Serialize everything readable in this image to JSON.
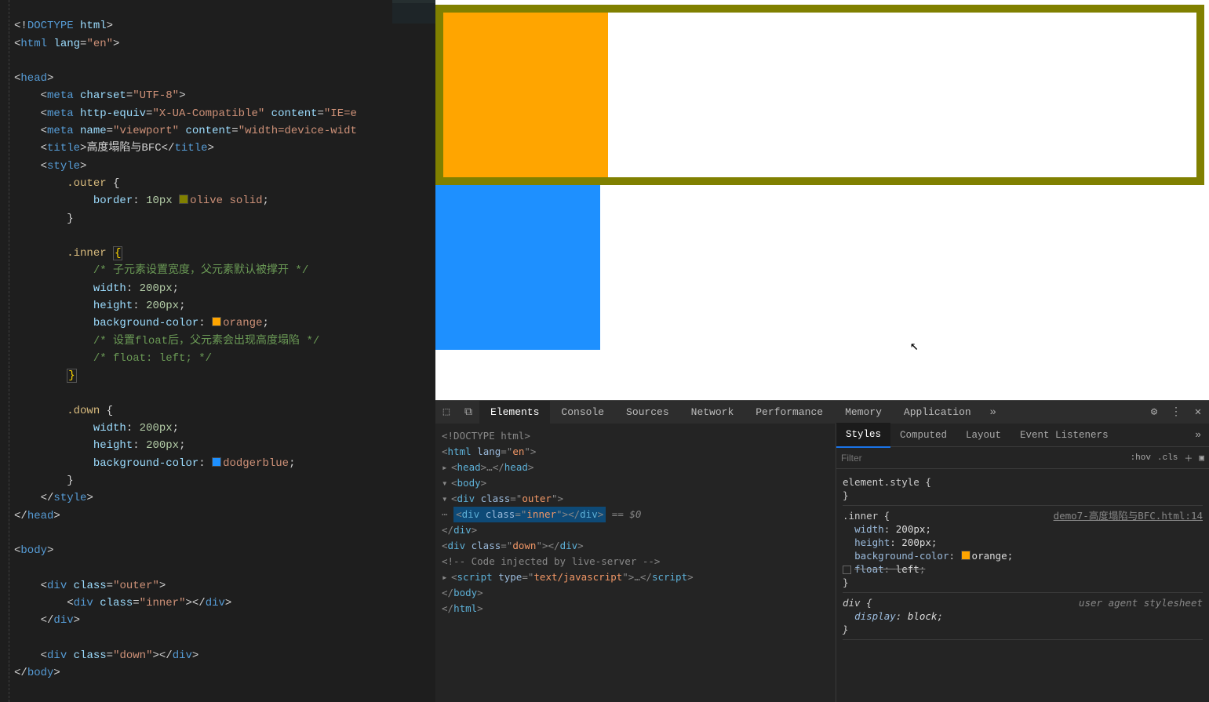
{
  "editor": {
    "l1a": "<!",
    "l1b": "DOCTYPE",
    "l1c": " html",
    "l1d": ">",
    "l2a": "<",
    "l2b": "html",
    "l2c": " lang",
    "l2d": "=",
    "l2e": "\"en\"",
    "l2f": ">",
    "l3a": "<",
    "l3b": "head",
    "l3c": ">",
    "l4a": "<",
    "l4b": "meta",
    "l4c": " charset",
    "l4d": "=",
    "l4e": "\"UTF-8\"",
    "l4f": ">",
    "l5a": "<",
    "l5b": "meta",
    "l5c": " http-equiv",
    "l5d": "=",
    "l5e": "\"X-UA-Compatible\"",
    "l5f": " content",
    "l5g": "=",
    "l5h": "\"IE=e",
    "l6a": "<",
    "l6b": "meta",
    "l6c": " name",
    "l6d": "=",
    "l6e": "\"viewport\"",
    "l6f": " content",
    "l6g": "=",
    "l6h": "\"width=device-widt",
    "l7a": "<",
    "l7b": "title",
    "l7c": ">",
    "l7d": "高度塌陷与BFC",
    "l7e": "</",
    "l7f": "title",
    "l7g": ">",
    "l8a": "<",
    "l8b": "style",
    "l8c": ">",
    "l9a": ".outer",
    "l9b": " {",
    "l10a": "border",
    "l10b": ": ",
    "l10c": "10px",
    "l10d": " ",
    "l10e": "olive",
    "l10f": " ",
    "l10g": "solid",
    "l10h": ";",
    "l11": "}",
    "l12a": ".inner",
    "l12b": " ",
    "l12c": "{",
    "l13": "/* 子元素设置宽度，父元素默认被撑开 */",
    "l14a": "width",
    "l14b": ": ",
    "l14c": "200px",
    "l14d": ";",
    "l15a": "height",
    "l15b": ": ",
    "l15c": "200px",
    "l15d": ";",
    "l16a": "background-color",
    "l16b": ": ",
    "l16c": "orange",
    "l16d": ";",
    "l17": "/* 设置float后，父元素会出现高度塌陷 */",
    "l18": "/* float: left; */",
    "l19": "}",
    "l20a": ".down",
    "l20b": " {",
    "l21a": "width",
    "l21b": ": ",
    "l21c": "200px",
    "l21d": ";",
    "l22a": "height",
    "l22b": ": ",
    "l22c": "200px",
    "l22d": ";",
    "l23a": "background-color",
    "l23b": ": ",
    "l23c": "dodgerblue",
    "l23d": ";",
    "l24": "}",
    "l25a": "</",
    "l25b": "style",
    "l25c": ">",
    "l26a": "</",
    "l26b": "head",
    "l26c": ">",
    "l27a": "<",
    "l27b": "body",
    "l27c": ">",
    "l28a": "<",
    "l28b": "div",
    "l28c": " class",
    "l28d": "=",
    "l28e": "\"outer\"",
    "l28f": ">",
    "l29a": "<",
    "l29b": "div",
    "l29c": " class",
    "l29d": "=",
    "l29e": "\"inner\"",
    "l29f": "></",
    "l29g": "div",
    "l29h": ">",
    "l30a": "</",
    "l30b": "div",
    "l30c": ">",
    "l31a": "<",
    "l31b": "div",
    "l31c": " class",
    "l31d": "=",
    "l31e": "\"down\"",
    "l31f": "></",
    "l31g": "div",
    "l31h": ">",
    "l32a": "</",
    "l32b": "body",
    "l32c": ">"
  },
  "devtools": {
    "tabs": {
      "elements": "Elements",
      "console": "Console",
      "sources": "Sources",
      "network": "Network",
      "performance": "Performance",
      "memory": "Memory",
      "application": "Application"
    },
    "dom": {
      "l1": "<!DOCTYPE html>",
      "l2a": "<",
      "l2b": "html",
      "l2c": " lang",
      "l2d": "=\"",
      "l2e": "en",
      "l2f": "\">",
      "l3a": "<",
      "l3b": "head",
      "l3c": ">",
      "l3d": "…",
      "l3e": "</",
      "l3f": "head",
      "l3g": ">",
      "l4a": "<",
      "l4b": "body",
      "l4c": ">",
      "l5a": "<",
      "l5b": "div",
      "l5c": " class",
      "l5d": "=\"",
      "l5e": "outer",
      "l5f": "\">",
      "l6a": "<",
      "l6b": "div",
      "l6c": " class",
      "l6d": "=\"",
      "l6e": "inner",
      "l6f": "\">",
      "l6g": "</",
      "l6h": "div",
      "l6i": ">",
      "l6j": " == $0",
      "l7a": "</",
      "l7b": "div",
      "l7c": ">",
      "l8a": "<",
      "l8b": "div",
      "l8c": " class",
      "l8d": "=\"",
      "l8e": "down",
      "l8f": "\">",
      "l8g": "</",
      "l8h": "div",
      "l8i": ">",
      "l9": "<!-- Code injected by live-server -->",
      "l10a": "<",
      "l10b": "script",
      "l10c": " type",
      "l10d": "=\"",
      "l10e": "text/javascript",
      "l10f": "\">",
      "l10g": "…",
      "l10h": "</",
      "l10i": "script",
      "l10j": ">",
      "l11a": "</",
      "l11b": "body",
      "l11c": ">",
      "l12a": "</",
      "l12b": "html",
      "l12c": ">"
    },
    "subtabs": {
      "styles": "Styles",
      "computed": "Computed",
      "layout": "Layout",
      "listeners": "Event Listeners"
    },
    "filter": {
      "placeholder": "Filter",
      "hov": ":hov",
      "cls": ".cls"
    },
    "rules": {
      "es": "element.style {",
      "esEnd": "}",
      "inner_sel": ".inner",
      "src": "demo7-高度塌陷与BFC.html:14",
      "width": "width",
      "wval": "200px",
      "height": "height",
      "hval": "200px",
      "bg": "background-color",
      "bgval": "orange",
      "float": "float",
      "floatval": "left",
      "div_sel": "div",
      "ua": "user agent stylesheet",
      "display": "display",
      "disval": "block",
      "brace_open": " {",
      "brace_close": "}",
      "colon": ": ",
      "semi": ";"
    }
  }
}
